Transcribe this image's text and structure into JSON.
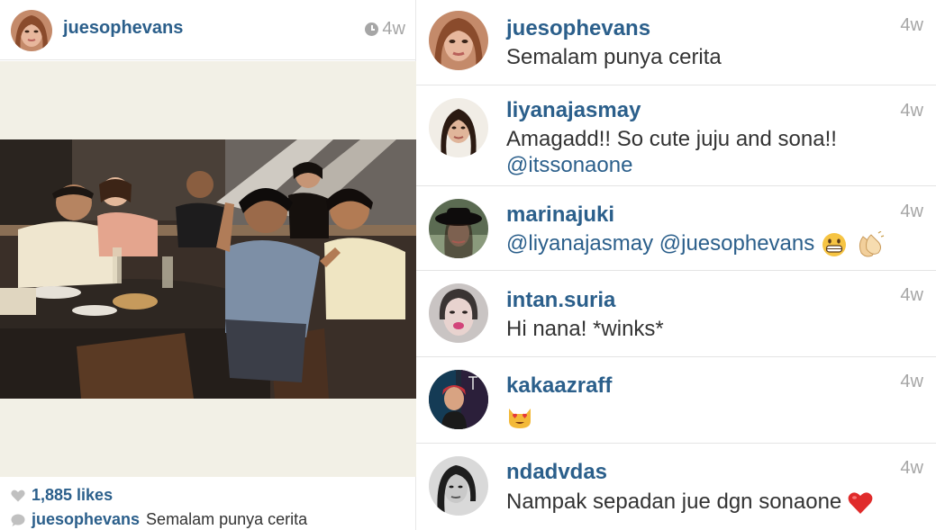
{
  "post": {
    "username": "juesophevans",
    "time": "4w",
    "likes": "1,885 likes",
    "caption_user": "juesophevans",
    "caption_text": "Semalam punya cerita",
    "icons": {
      "clock": "clock-icon",
      "heart": "heart-icon",
      "comment": "comment-icon"
    }
  },
  "comments": [
    {
      "user": "juesophevans",
      "text": "Semalam punya cerita",
      "time": "4w"
    },
    {
      "user": "liyanajasmay",
      "text": "Amagadd!! So cute juju and sona!!",
      "mention": "@itssonaone",
      "time": "4w"
    },
    {
      "user": "marinajuki",
      "text": "@liyanajasmay @juesophevans",
      "time": "4w",
      "emojis": [
        "grinning-face",
        "clapping-hands"
      ]
    },
    {
      "user": "intan.suria",
      "text": "Hi nana! *winks*",
      "time": "4w"
    },
    {
      "user": "kakaazraff",
      "text": "",
      "time": "4w",
      "emojis": [
        "heart-eyes-cat"
      ]
    },
    {
      "user": "ndadvdas",
      "text": "Nampak sepadan jue dgn sonaone",
      "time": "4w",
      "emojis": [
        "red-heart"
      ]
    }
  ],
  "colors": {
    "link": "#2b5f8b",
    "muted": "#a6a6a6",
    "text": "#333333",
    "media_bg": "#f2f0e6"
  }
}
